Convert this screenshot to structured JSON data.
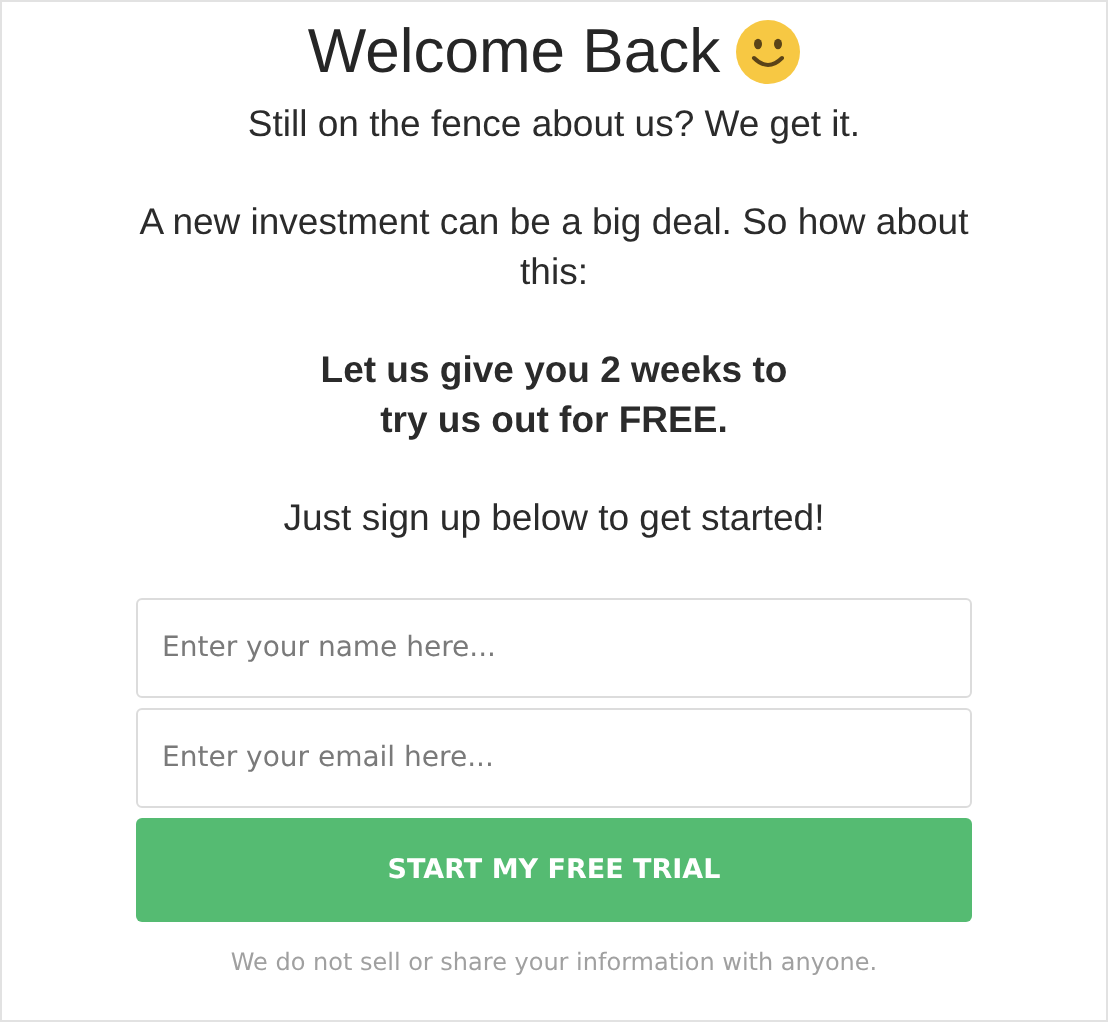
{
  "title": "Welcome Back",
  "paragraphs": [
    {
      "kind": "plain",
      "text": "Still on the fence about us? We get it."
    },
    {
      "kind": "plain",
      "text": "A new investment can be a big deal. So how about this:"
    },
    {
      "kind": "bold",
      "text": "Let us give you 2 weeks to\ntry us out for FREE."
    },
    {
      "kind": "plain",
      "text": "Just sign up below to get started!"
    }
  ],
  "fields": [
    {
      "placeholder": "Enter your name here..."
    },
    {
      "placeholder": "Enter your email here..."
    }
  ],
  "button": "START MY FREE TRIAL",
  "disclaimer": "We do not sell or share your information with anyone."
}
